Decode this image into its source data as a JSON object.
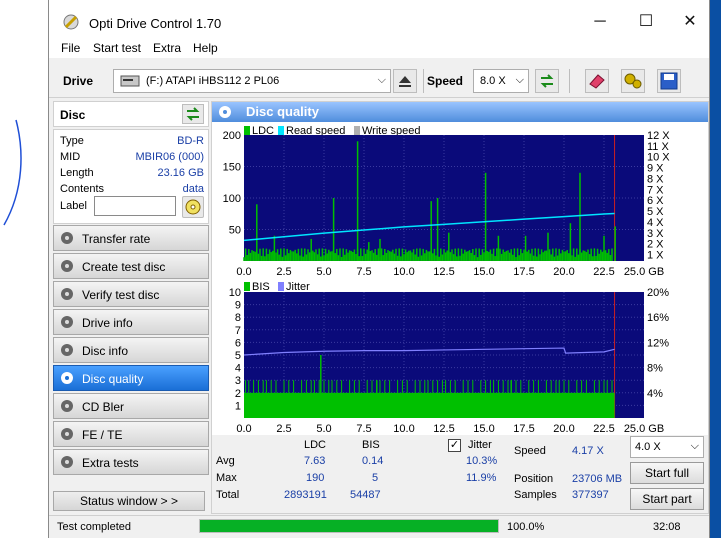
{
  "window": {
    "title": "Opti Drive Control 1.70",
    "minimize_glyph": "─",
    "maximize_glyph": "☐",
    "close_glyph": "✕"
  },
  "menu": [
    "File",
    "Start test",
    "Extra",
    "Help"
  ],
  "toolbar": {
    "drive_label": "Drive",
    "drive_value": "(F:)   ATAPI iHBS112   2 PL06",
    "speed_label": "Speed",
    "speed_value": "8.0 X"
  },
  "disc": {
    "header": "Disc",
    "info": [
      {
        "k": "Type",
        "v": "BD-R"
      },
      {
        "k": "MID",
        "v": "MBIR06 (000)"
      },
      {
        "k": "Length",
        "v": "23.16 GB"
      },
      {
        "k": "Contents",
        "v": "data"
      }
    ],
    "label_field": "Label",
    "label_value": ""
  },
  "nav": [
    {
      "label": "Transfer rate",
      "active": false
    },
    {
      "label": "Create test disc",
      "active": false
    },
    {
      "label": "Verify test disc",
      "active": false
    },
    {
      "label": "Drive info",
      "active": false
    },
    {
      "label": "Disc info",
      "active": false
    },
    {
      "label": "Disc quality",
      "active": true
    },
    {
      "label": "CD Bler",
      "active": false
    },
    {
      "label": "FE / TE",
      "active": false
    },
    {
      "label": "Extra tests",
      "active": false
    }
  ],
  "status_window_label": "Status window > >",
  "main_title": "Disc quality",
  "chart_data": [
    {
      "type": "bar",
      "legend": [
        {
          "name": "LDC",
          "color": "#00c000"
        },
        {
          "name": "Read speed",
          "color": "#00e5ff"
        },
        {
          "name": "Write speed",
          "color": "#b0b0b0"
        }
      ],
      "x_ticks": [
        "0.0",
        "2.5",
        "5.0",
        "7.5",
        "10.0",
        "12.5",
        "15.0",
        "17.5",
        "20.0",
        "22.5",
        "25.0 GB"
      ],
      "y_ticks_left": [
        "200",
        "150",
        "100",
        "50"
      ],
      "y_ticks_right": [
        "12 X",
        "11 X",
        "10 X",
        "9 X",
        "8 X",
        "7 X",
        "6 X",
        "5 X",
        "4 X",
        "3 X",
        "2 X",
        "1 X"
      ],
      "xlim": [
        0,
        25
      ],
      "ylim": [
        0,
        200
      ],
      "ldc_baseline": [
        0,
        20
      ],
      "ldc_spikes": [
        [
          0.8,
          90
        ],
        [
          1.9,
          40
        ],
        [
          4.2,
          35
        ],
        [
          5.6,
          100
        ],
        [
          7.1,
          190
        ],
        [
          7.8,
          30
        ],
        [
          8.5,
          35
        ],
        [
          11.7,
          95
        ],
        [
          12.1,
          100
        ],
        [
          12.8,
          45
        ],
        [
          15.1,
          140
        ],
        [
          15.9,
          40
        ],
        [
          17.6,
          40
        ],
        [
          19.0,
          45
        ],
        [
          20.4,
          60
        ],
        [
          21.0,
          140
        ],
        [
          22.5,
          40
        ],
        [
          23.2,
          55
        ]
      ],
      "read_speed": {
        "x": [
          0,
          2.5,
          5,
          7.5,
          10,
          12.5,
          15,
          17.5,
          20,
          22.5,
          23.16
        ],
        "y": [
          2.0,
          2.35,
          2.7,
          3.0,
          3.3,
          3.55,
          3.8,
          4.05,
          4.3,
          4.55,
          4.6
        ]
      }
    },
    {
      "type": "bar",
      "legend": [
        {
          "name": "BIS",
          "color": "#00c000"
        },
        {
          "name": "Jitter",
          "color": "#8080ff"
        }
      ],
      "x_ticks": [
        "0.0",
        "2.5",
        "5.0",
        "7.5",
        "10.0",
        "12.5",
        "15.0",
        "17.5",
        "20.0",
        "22.5",
        "25.0 GB"
      ],
      "y_ticks_left": [
        "10",
        "9",
        "8",
        "7",
        "6",
        "5",
        "4",
        "3",
        "2",
        "1"
      ],
      "y_ticks_right": [
        "20%",
        "16%",
        "12%",
        "8%",
        "4%"
      ],
      "xlim": [
        0,
        25
      ],
      "ylim": [
        0,
        10
      ],
      "bis_level": 2,
      "bis_spikes": [
        [
          4.8,
          5
        ],
        [
          8.3,
          3
        ],
        [
          16.7,
          3
        ]
      ],
      "jitter": {
        "x": [
          0,
          2.5,
          5,
          7.5,
          10,
          12.5,
          15,
          17.5,
          20.0,
          20.1,
          22.5,
          23.16
        ],
        "y": [
          10.0,
          10.4,
          10.6,
          10.7,
          10.7,
          10.8,
          10.9,
          11.0,
          11.1,
          10.3,
          10.5,
          10.9
        ]
      }
    }
  ],
  "stats": {
    "col_ldc": "LDC",
    "col_bis": "BIS",
    "jitter_label": "Jitter",
    "jitter_checked": "✓",
    "rows": [
      {
        "label": "Avg",
        "ldc": "7.63",
        "bis": "0.14",
        "jitter": "10.3%"
      },
      {
        "label": "Max",
        "ldc": "190",
        "bis": "5",
        "jitter": "11.9%"
      },
      {
        "label": "Total",
        "ldc": "2893191",
        "bis": "54487",
        "jitter": ""
      }
    ],
    "speed_label": "Speed",
    "speed_value": "4.17 X",
    "speed_select": "4.0 X",
    "position_label": "Position",
    "position_value": "23706 MB",
    "samples_label": "Samples",
    "samples_value": "377397",
    "start_full": "Start full",
    "start_part": "Start part"
  },
  "status": {
    "text": "Test completed",
    "progress": 1.0,
    "percent": "100.0%",
    "time": "32:08"
  },
  "colors": {
    "accent": "#1a6fd6",
    "chart_bg": "#0a0a7a",
    "ldc": "#00c000",
    "read_speed": "#00e5ff",
    "jitter": "#8080ff",
    "progress": "#06b025"
  }
}
